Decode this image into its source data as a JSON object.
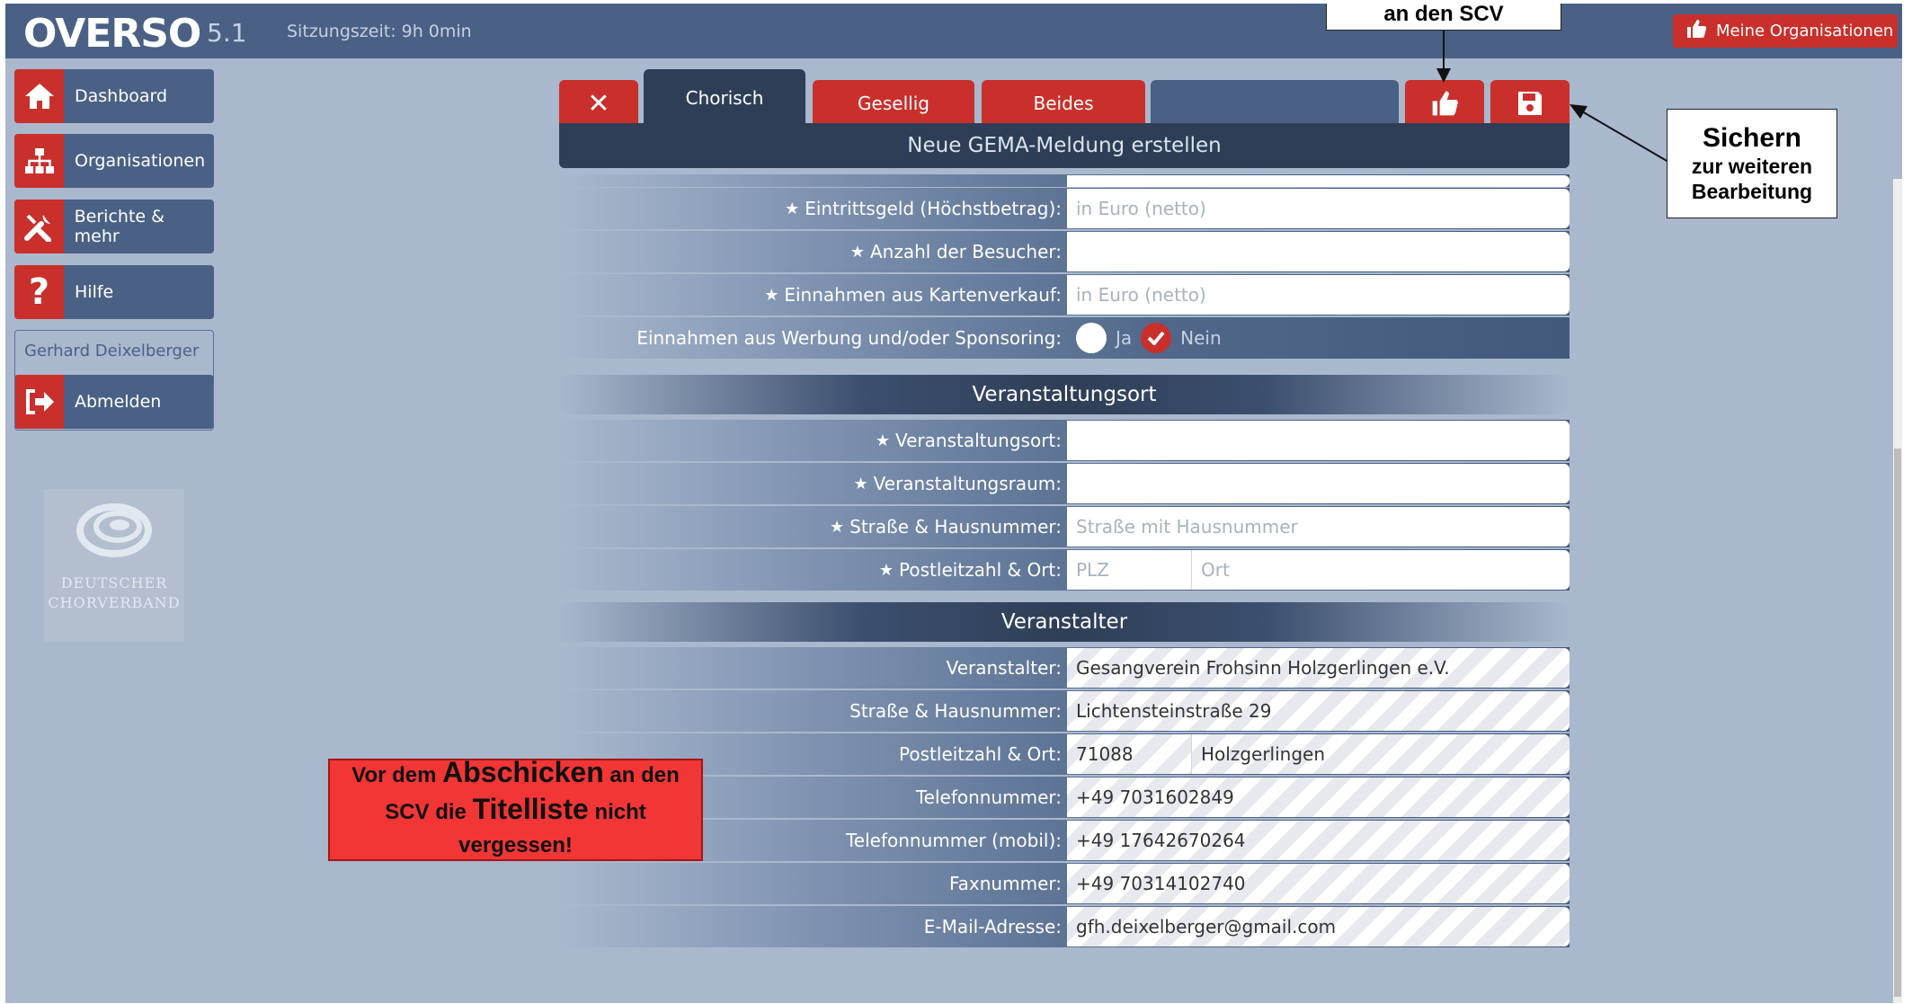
{
  "header": {
    "logo": "OVERSO",
    "version": "5.1",
    "session": "Sitzungszeit: 9h 0min",
    "orgs_button": "Meine Organisationen"
  },
  "sidebar": {
    "items": [
      {
        "label": "Dashboard",
        "icon": "home-icon"
      },
      {
        "label": "Organisationen",
        "icon": "sitemap-icon"
      },
      {
        "label": "Berichte & mehr",
        "icon": "tools-icon"
      },
      {
        "label": "Hilfe",
        "icon": "question-icon"
      }
    ],
    "user": "Gerhard Deixelberger",
    "logout": "Abmelden",
    "brand_line1": "Deutscher",
    "brand_line2": "Chorverband"
  },
  "tabs": {
    "items": [
      "Chorisch",
      "Gesellig",
      "Beides"
    ],
    "form_title": "Neue GEMA-Meldung erstellen"
  },
  "form": {
    "eintritt_label": "Eintrittsgeld (Höchstbetrag):",
    "eintritt_ph": "in Euro (netto)",
    "besucher_label": "Anzahl der Besucher:",
    "karten_label": "Einnahmen aus Kartenverkauf:",
    "karten_ph": "in Euro (netto)",
    "werbung_label": "Einnahmen aus Werbung und/oder Sponsoring:",
    "ja": "Ja",
    "nein": "Nein",
    "section_ort": "Veranstaltungsort",
    "ort_label": "Veranstaltungsort:",
    "raum_label": "Veranstaltungsraum:",
    "strasse_label": "Straße & Hausnummer:",
    "strasse_ph": "Straße mit Hausnummer",
    "plz_label": "Postleitzahl & Ort:",
    "plz_ph": "PLZ",
    "ortfeld_ph": "Ort",
    "section_veranstalter": "Veranstalter",
    "v_label": "Veranstalter:",
    "v_value": "Gesangverein Frohsinn Holzgerlingen e.V.",
    "v_strasse_label": "Straße & Hausnummer:",
    "v_strasse_value": "Lichtensteinstraße 29",
    "v_plz_label": "Postleitzahl & Ort:",
    "v_plz_value": "71088",
    "v_ort_value": "Holzgerlingen",
    "tel_label": "Telefonnummer:",
    "tel_value": "+49 7031602849",
    "mobil_label": "Telefonnummer (mobil):",
    "mobil_value": "+49 17642670264",
    "fax_label": "Faxnummer:",
    "fax_value": "+49 70314102740",
    "mail_label": "E-Mail-Adresse:",
    "mail_value": "gfh.deixelberger@gmail.com"
  },
  "annotations": {
    "top": "an den SCV",
    "right_big": "Sichern",
    "right_l1": "zur weiteren",
    "right_l2": "Bearbeitung",
    "red_p1": "Vor dem ",
    "red_p2": "Abschicken",
    "red_p3": " an den SCV die ",
    "red_p4": "Titelliste",
    "red_p5": " nicht vergessen!"
  },
  "colors": {
    "accent_red": "#c9302c",
    "nav_blue": "#4a6185",
    "dark_navy": "#2e3e56",
    "background": "#a9b8cd"
  }
}
